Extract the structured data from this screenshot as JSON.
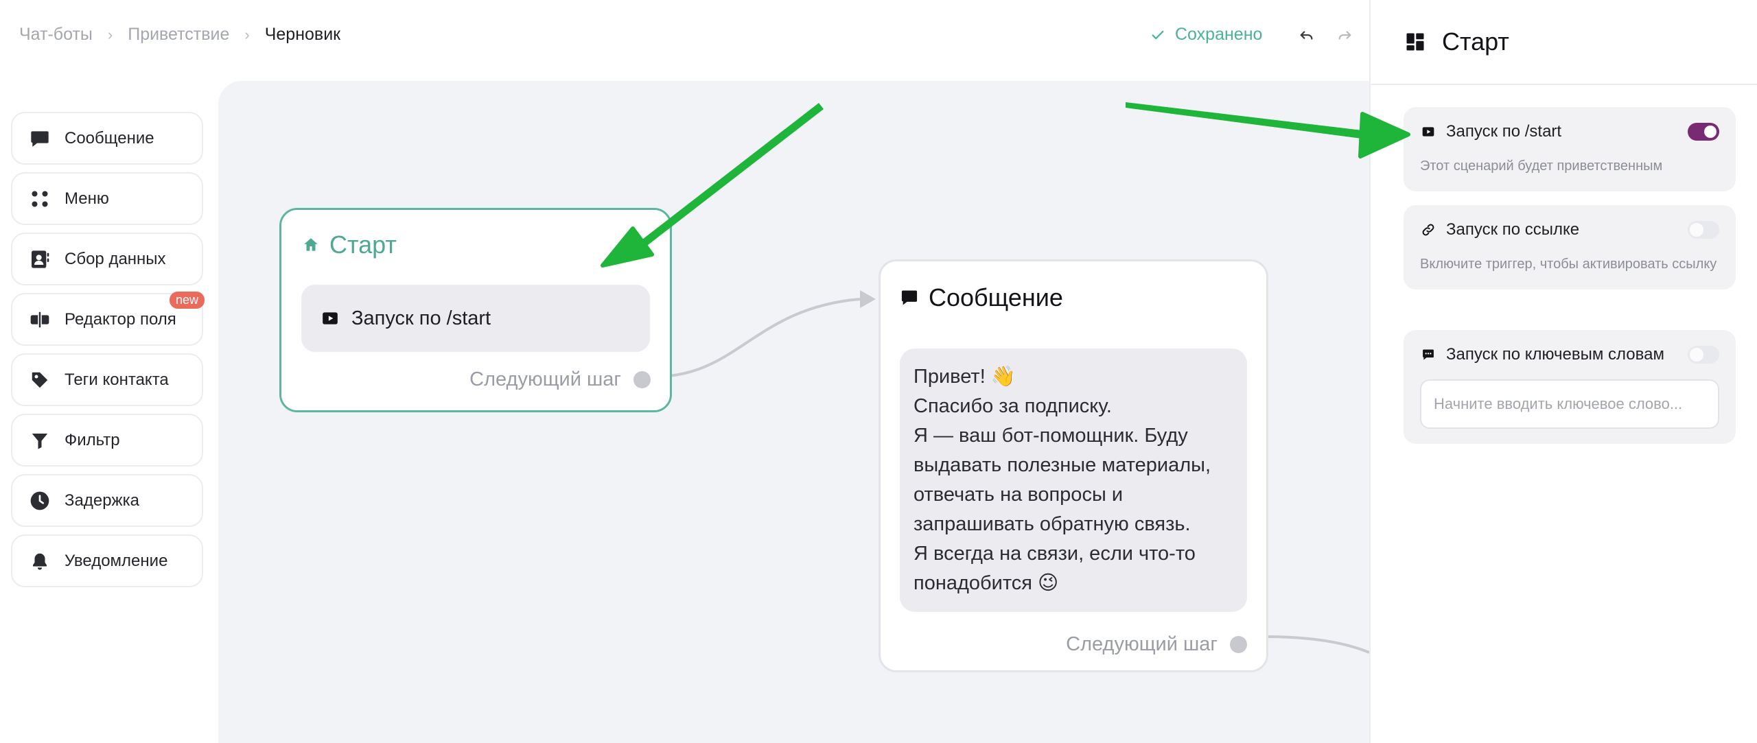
{
  "breadcrumb": {
    "items": [
      "Чат-боты",
      "Приветствие"
    ],
    "current": "Черновик",
    "separator": "›"
  },
  "status": {
    "saved_label": "Сохранено"
  },
  "toolbar": {
    "undo_icon": "undo-icon",
    "redo_icon": "redo-icon"
  },
  "tools": [
    {
      "label": "Сообщение",
      "icon": "message-icon"
    },
    {
      "label": "Меню",
      "icon": "grid-icon"
    },
    {
      "label": "Сбор данных",
      "icon": "contact-card-icon"
    },
    {
      "label": "Редактор поля",
      "icon": "field-editor-icon",
      "badge": "new"
    },
    {
      "label": "Теги контакта",
      "icon": "tag-icon"
    },
    {
      "label": "Фильтр",
      "icon": "filter-icon"
    },
    {
      "label": "Задержка",
      "icon": "clock-icon"
    },
    {
      "label": "Уведомление",
      "icon": "bell-icon"
    }
  ],
  "start_node": {
    "title": "Старт",
    "trigger": "Запуск по /start",
    "next_label": "Следующий шаг"
  },
  "message_node": {
    "title": "Сообщение",
    "lines": [
      "Привет! 👋",
      "Спасибо за подписку.",
      "Я — ваш бот-помощник. Буду",
      "выдавать полезные материалы,",
      "отвечать на вопросы и",
      "запрашивать обратную связь.",
      "Я всегда на связи, если что-то",
      "понадобится 😉"
    ],
    "next_label": "Следующий шаг"
  },
  "panel": {
    "title": "Старт",
    "triggers": [
      {
        "label": "Запуск по /start",
        "desc": "Этот сценарий будет приветственным",
        "enabled": true
      },
      {
        "label": "Запуск по ссылке",
        "desc": "Включите триггер, чтобы активировать ссылку",
        "enabled": false
      },
      {
        "label": "Запуск по ключевым словам",
        "placeholder": "Начните вводить ключевое слово...",
        "enabled": false
      }
    ]
  },
  "colors": {
    "accent_green": "#5eb6a1",
    "toggle_on": "#7a2a73",
    "annotation_arrow": "#1fb43a",
    "badge": "#ec6a5c"
  }
}
